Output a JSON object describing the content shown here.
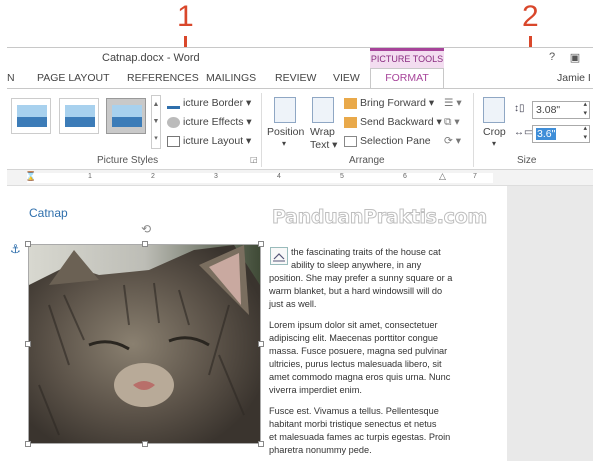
{
  "callouts": [
    "1",
    "2"
  ],
  "window": {
    "title": "Catnap.docx - Word",
    "context_tab_group": "PICTURE TOOLS",
    "controls": [
      "?",
      "▣"
    ],
    "user": "Jamie I"
  },
  "tabs": [
    "N",
    "PAGE LAYOUT",
    "REFERENCES",
    "MAILINGS",
    "REVIEW",
    "VIEW"
  ],
  "active_tab": "FORMAT",
  "ribbon": {
    "picture_styles": {
      "label": "Picture Styles",
      "items": [
        "Picture Border",
        "Picture Effects",
        "Picture Layout"
      ],
      "item_prefix_cut": [
        "icture Border",
        "icture Effects",
        "icture Layout"
      ]
    },
    "arrange": {
      "label": "Arrange",
      "position": "Position",
      "wrap_line1": "Wrap",
      "wrap_line2": "Text",
      "bring_forward": "Bring Forward",
      "send_backward": "Send Backward",
      "selection_pane": "Selection Pane"
    },
    "size": {
      "label": "Size",
      "crop": "Crop",
      "height": "3.08\"",
      "width": "3.6\""
    }
  },
  "ruler": [
    "1",
    "2",
    "3",
    "4",
    "5",
    "6",
    "7"
  ],
  "document": {
    "heading": "Catnap",
    "watermark": "PanduanPraktis.com",
    "paragraphs": [
      [
        "the fascinating traits of the house cat",
        "ability to sleep anywhere, in any",
        "position. She may prefer a sunny square or a",
        "warm blanket, but a hard windowsill will do",
        "just as well."
      ],
      [
        "Lorem ipsum dolor sit amet, consectetuer",
        "adipiscing elit. Maecenas porttitor congue",
        "massa. Fusce posuere, magna sed pulvinar",
        "ultricies, purus lectus malesuada libero, sit",
        "amet commodo magna eros quis urna. Nunc",
        "viverra imperdiet enim."
      ],
      [
        "Fusce est. Vivamus a tellus. Pellentesque",
        "habitant morbi tristique senectus et netus",
        "et malesuada fames ac turpis egestas. Proin",
        "pharetra nonummy pede."
      ]
    ]
  },
  "colors": {
    "accent": "#a7449a",
    "callout": "#d9472b",
    "heading": "#2f6fac",
    "selection": "#3f8ed8"
  }
}
